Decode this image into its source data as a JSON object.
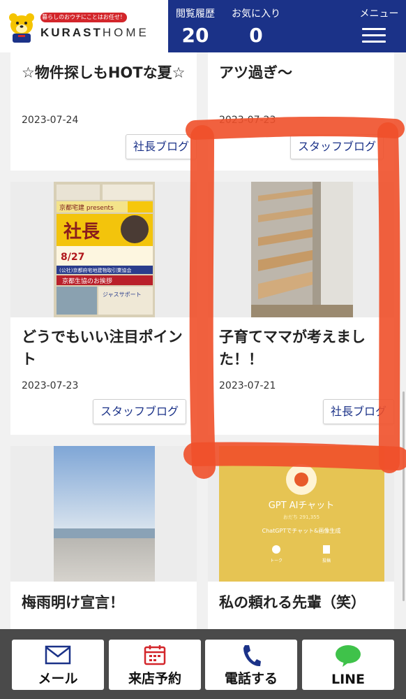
{
  "header": {
    "tagline": "暮らしのおウチにことはお任せ！",
    "brand_main": "KURAST",
    "brand_home": "HOME",
    "history_label": "閲覧履歴",
    "history_count": "20",
    "favorites_label": "お気に入り",
    "favorites_count": "0",
    "menu_label": "メニュー"
  },
  "posts": [
    {
      "title": "☆物件探しもHOTな夏☆",
      "date": "2023-07-24",
      "category": "社長ブログ"
    },
    {
      "title": "アツ過ぎ～",
      "date": "2023-07-23",
      "category": "スタッフブログ"
    },
    {
      "title": "どうでもいい注目ポイント",
      "date": "2023-07-23",
      "category": "スタッフブログ"
    },
    {
      "title": "子育てママが考えました！！",
      "date": "2023-07-21",
      "category": "社長ブログ"
    },
    {
      "title": "梅雨明け宣言！"
    },
    {
      "title": "私の頼れる先輩（笑）"
    }
  ],
  "flyer": {
    "brand": "京都宅建 presents",
    "headline": "社長",
    "date_text": "8/27",
    "org": "(公社)京都府宅地建物取引業協会",
    "greeting": "京都生協のお挨拶",
    "support": "ジャスサポート"
  },
  "gpt_card": {
    "title": "GPT AIチャット",
    "meta": "おだち 291,355",
    "subtitle": "ChatGPTでチャット&画像生成",
    "talk_label": "トーク",
    "post_label": "投稿"
  },
  "bottom_bar": {
    "mail_label": "メール",
    "reserve_label": "来店予約",
    "phone_label": "電話する",
    "line_label": "LINE"
  },
  "colors": {
    "navy": "#1b3288",
    "accent_red": "#d3262b",
    "annotation_red": "#f0502a",
    "line_green": "#3fc24a"
  }
}
